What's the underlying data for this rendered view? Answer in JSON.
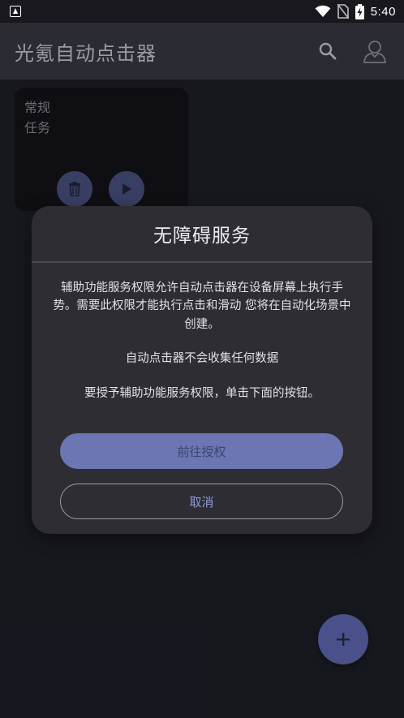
{
  "status_bar": {
    "time": "5:40",
    "icons": [
      "notification-a-icon",
      "wifi-icon",
      "no-sim-icon",
      "battery-charging-icon"
    ]
  },
  "app_bar": {
    "title": "光氪自动点击器",
    "actions": [
      "search-icon",
      "account-icon"
    ]
  },
  "task_card": {
    "name_line1": "常规",
    "name_line2": "任务",
    "buttons": [
      "trash-icon",
      "play-icon"
    ]
  },
  "dialog": {
    "title": "无障碍服务",
    "paragraph1": "辅助功能服务权限允许自动点击器在设备屏幕上执行手势。需要此权限才能执行点击和滑动 您将在自动化场景中创建。",
    "paragraph2": "自动点击器不会收集任何数据",
    "paragraph3": "要授予辅助功能服务权限，单击下面的按钮。",
    "primary_button": "前往授权",
    "secondary_button": "取消"
  },
  "fab": {
    "icon": "plus-icon"
  },
  "colors": {
    "background": "#1f2029",
    "app_bar": "#2a2b33",
    "dialog": "#2d2d33",
    "primary": "#6b76b3",
    "accent_text": "#8f99d6",
    "fab": "#49508a"
  }
}
